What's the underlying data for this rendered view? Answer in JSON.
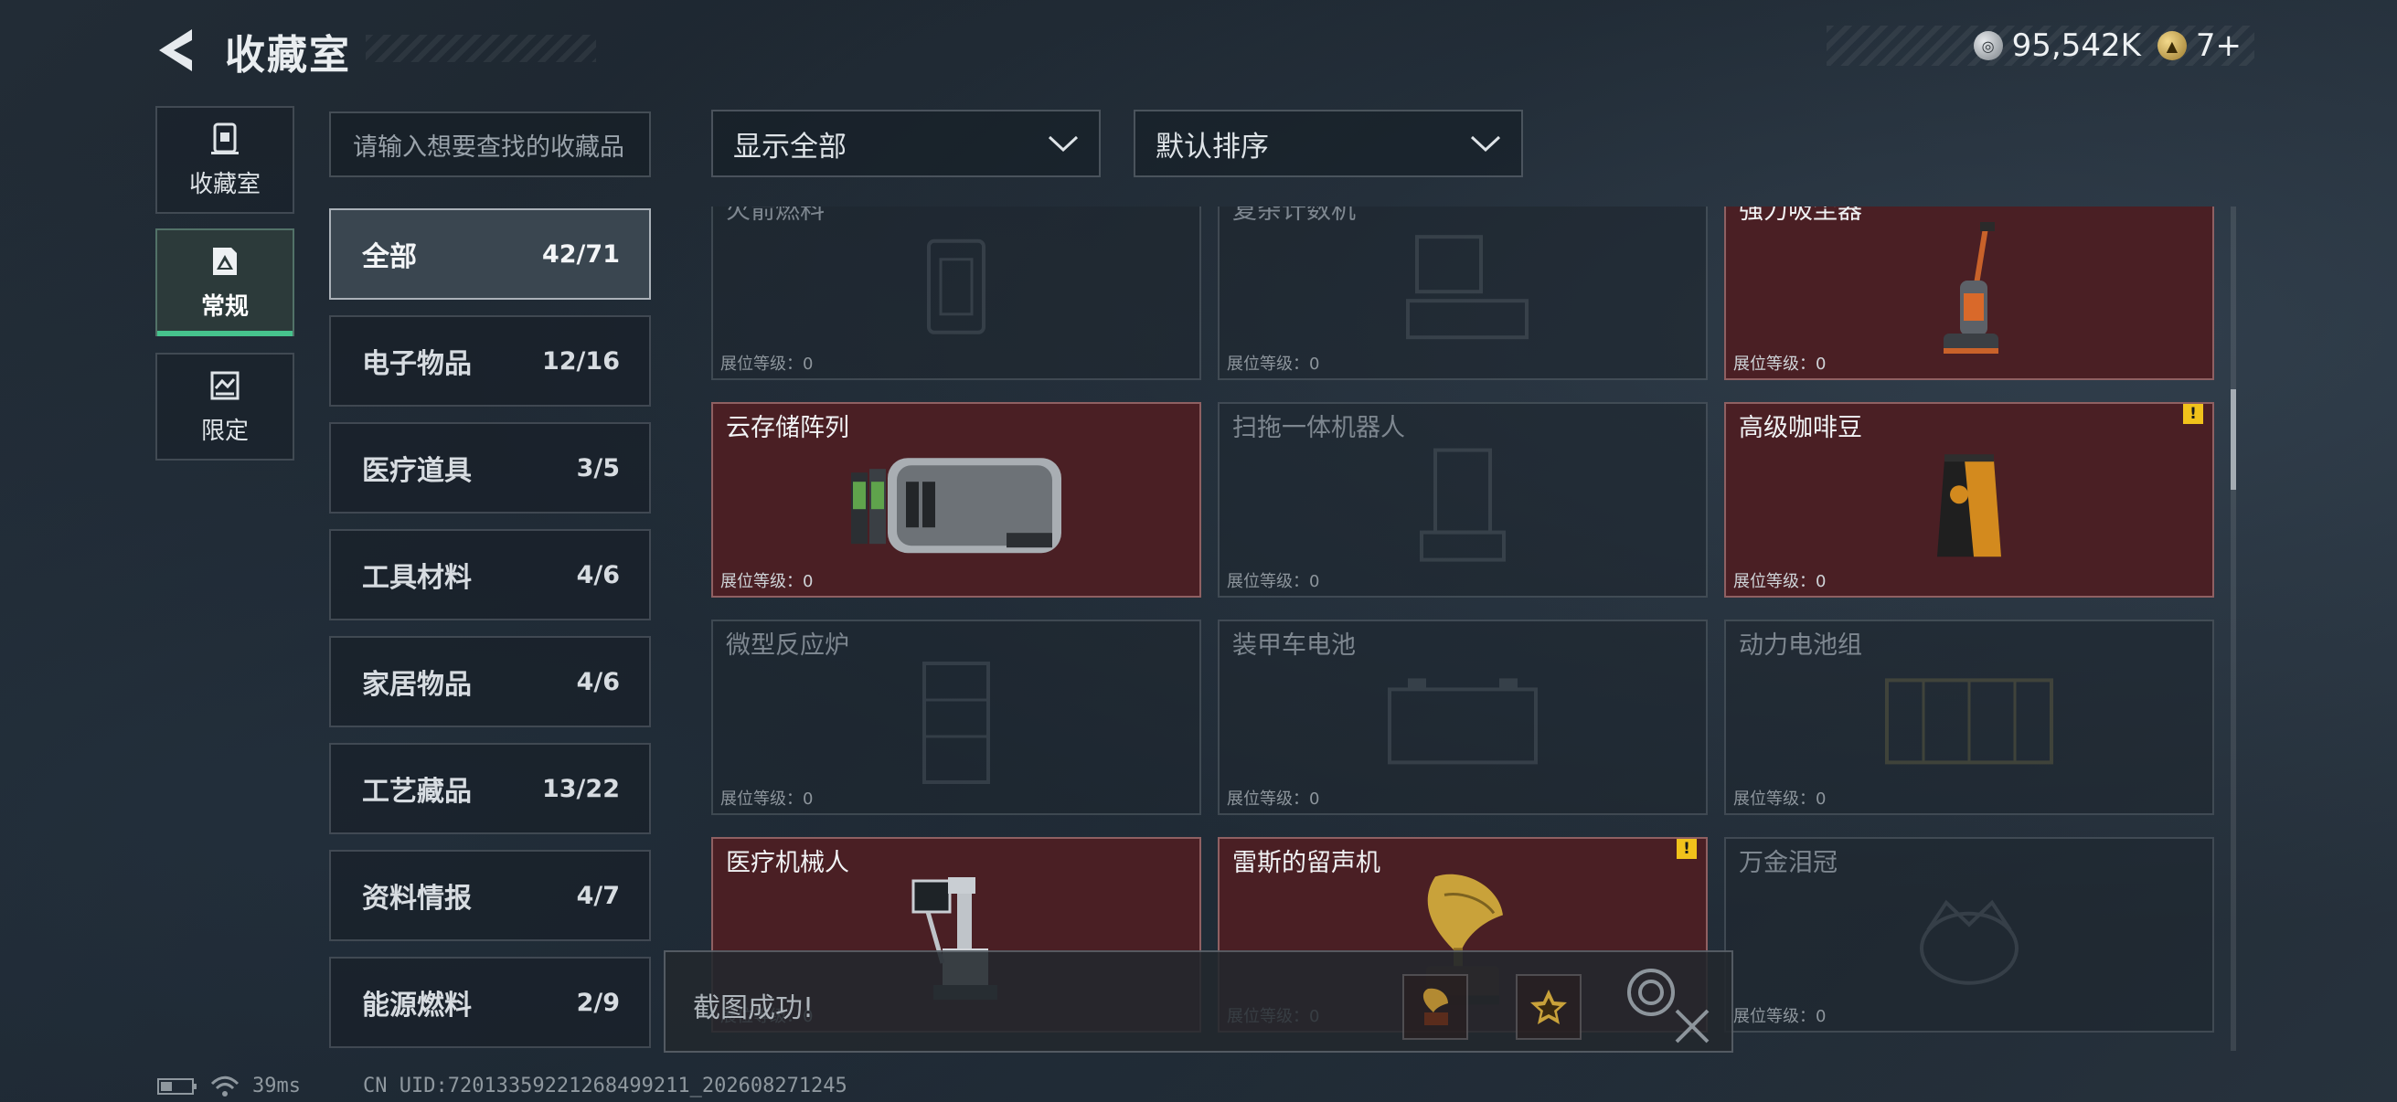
{
  "header": {
    "title": "收藏室",
    "currencies": [
      {
        "icon": "silver-coin-icon",
        "value": "95,542K"
      },
      {
        "icon": "gold-coin-icon",
        "value": "7+"
      }
    ]
  },
  "mode_tabs": [
    {
      "label": "收藏室",
      "icon": "collection-room-icon",
      "active": false
    },
    {
      "label": "常规",
      "icon": "regular-gallery-icon",
      "active": true
    },
    {
      "label": "限定",
      "icon": "limited-gallery-icon",
      "active": false
    }
  ],
  "search": {
    "placeholder": "请输入想要查找的收藏品"
  },
  "categories": [
    {
      "label": "全部",
      "count": "42/71",
      "active": true
    },
    {
      "label": "电子物品",
      "count": "12/16"
    },
    {
      "label": "医疗道具",
      "count": "3/5"
    },
    {
      "label": "工具材料",
      "count": "4/6"
    },
    {
      "label": "家居物品",
      "count": "4/6"
    },
    {
      "label": "工艺藏品",
      "count": "13/22"
    },
    {
      "label": "资料情报",
      "count": "4/7"
    },
    {
      "label": "能源燃料",
      "count": "2/9"
    }
  ],
  "filters": {
    "display": "显示全部",
    "sort": "默认排序"
  },
  "level_label": "展位等级：",
  "items": [
    {
      "name": "火箭燃料",
      "level": "0",
      "owned": false,
      "alert": false,
      "icon": "rocket-fuel-icon"
    },
    {
      "name": "复杂计数机",
      "level": "0",
      "owned": false,
      "alert": false,
      "icon": "computer-icon"
    },
    {
      "name": "强力吸尘器",
      "level": "0",
      "owned": true,
      "alert": false,
      "icon": "vacuum-cleaner-icon"
    },
    {
      "name": "云存储阵列",
      "level": "0",
      "owned": true,
      "alert": false,
      "icon": "cloud-storage-array-icon"
    },
    {
      "name": "扫拖一体机器人",
      "level": "0",
      "owned": false,
      "alert": false,
      "icon": "mop-robot-icon"
    },
    {
      "name": "高级咖啡豆",
      "level": "0",
      "owned": true,
      "alert": true,
      "icon": "coffee-beans-icon"
    },
    {
      "name": "微型反应炉",
      "level": "0",
      "owned": false,
      "alert": false,
      "icon": "micro-reactor-icon"
    },
    {
      "name": "装甲车电池",
      "level": "0",
      "owned": false,
      "alert": false,
      "icon": "armored-battery-icon"
    },
    {
      "name": "动力电池组",
      "level": "0",
      "owned": false,
      "alert": false,
      "icon": "power-battery-pack-icon"
    },
    {
      "name": "医疗机械人",
      "level": "0",
      "owned": true,
      "alert": false,
      "icon": "medical-robot-icon"
    },
    {
      "name": "雷斯的留声机",
      "level": "0",
      "owned": true,
      "alert": true,
      "icon": "gramophone-icon"
    },
    {
      "name": "万金泪冠",
      "level": "0",
      "owned": false,
      "alert": false,
      "icon": "crown-icon"
    }
  ],
  "toast": {
    "text": "截图成功!"
  },
  "footer": {
    "ping": "39ms",
    "uid": "CN UID:7201335922126849921​1_202608271245"
  }
}
